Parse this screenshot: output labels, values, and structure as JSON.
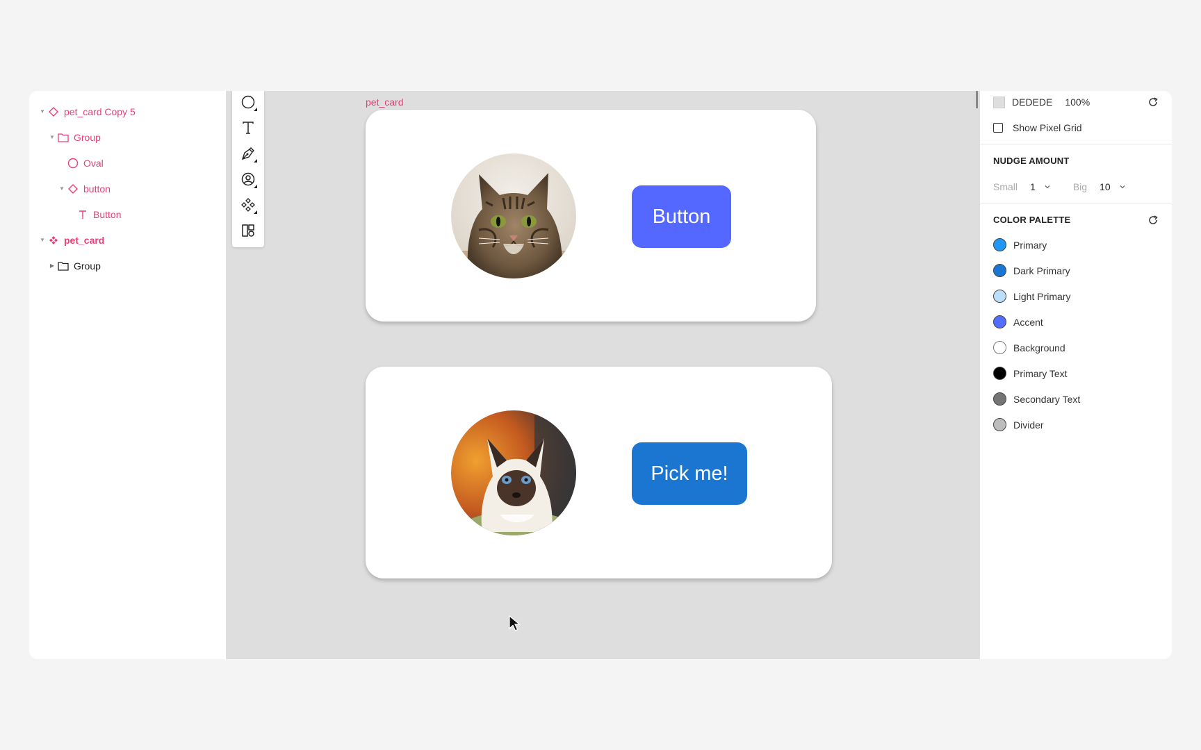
{
  "layers": [
    {
      "label": "pet_card Copy 5",
      "icon": "component-instance-icon"
    },
    {
      "label": "Group",
      "icon": "folder-icon"
    },
    {
      "label": "Oval",
      "icon": "oval-icon"
    },
    {
      "label": "button",
      "icon": "component-instance-icon"
    },
    {
      "label": "Button",
      "icon": "text-icon"
    },
    {
      "label": "pet_card",
      "icon": "component-icon"
    },
    {
      "label": "Group",
      "icon": "folder-icon"
    }
  ],
  "canvas": {
    "frame_label": "pet_card",
    "cards": [
      {
        "button_label": "Button",
        "button_color": "#5468ff",
        "image": "tabby-cat-photo"
      },
      {
        "button_label": "Pick me!",
        "button_color": "#1b76d2",
        "image": "siamese-kitten-photo"
      }
    ]
  },
  "tools": [
    "oval-tool-icon",
    "text-tool-icon",
    "pen-tool-icon",
    "avatar-tool-icon",
    "components-tool-icon",
    "layout-tool-icon"
  ],
  "properties": {
    "background": {
      "hex": "DEDEDE",
      "opacity": "100%",
      "color": "#dedede"
    },
    "pixel_grid_label": "Show Pixel Grid",
    "nudge": {
      "title": "NUDGE AMOUNT",
      "small_label": "Small",
      "small_value": "1",
      "big_label": "Big",
      "big_value": "10"
    },
    "palette": {
      "title": "COLOR PALETTE",
      "colors": [
        {
          "name": "Primary",
          "color": "#2196f3"
        },
        {
          "name": "Dark Primary",
          "color": "#1976d2"
        },
        {
          "name": "Light Primary",
          "color": "#bbdefb"
        },
        {
          "name": "Accent",
          "color": "#536dfe"
        },
        {
          "name": "Background",
          "color": "#ffffff"
        },
        {
          "name": "Primary Text",
          "color": "#000000"
        },
        {
          "name": "Secondary Text",
          "color": "#757575"
        },
        {
          "name": "Divider",
          "color": "#bdbdbd"
        }
      ]
    }
  }
}
